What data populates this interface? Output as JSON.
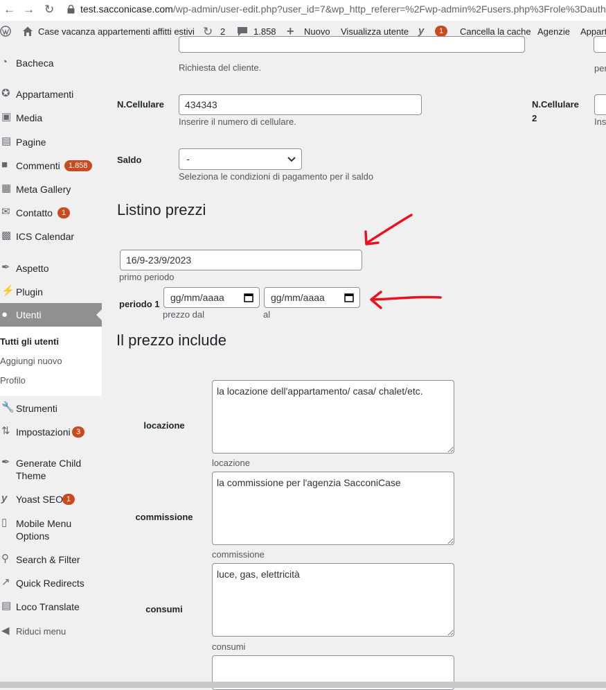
{
  "browser": {
    "url_host": "test.sacconicase.com",
    "url_rest": "/wp-admin/user-edit.php?user_id=7&wp_http_referer=%2Fwp-admin%2Fusers.php%3Frole%3Dauth"
  },
  "adminbar": {
    "site_name": "Case vacanza appartementi affitti estivi",
    "updates_count": "2",
    "comments_count": "1.858",
    "new_label": "Nuovo",
    "view_user": "Visualizza utente",
    "yoast_count": "1",
    "clear_cache": "Cancella la cache",
    "agenzie": "Agenzie",
    "appart": "Appart"
  },
  "sidebar": {
    "items": [
      {
        "label": "Bacheca",
        "icon": "dashboard-icon"
      },
      {
        "label": "Appartamenti",
        "icon": "pin-icon"
      },
      {
        "label": "Media",
        "icon": "media-icon"
      },
      {
        "label": "Pagine",
        "icon": "page-icon"
      },
      {
        "label": "Commenti",
        "icon": "comment-icon",
        "badge": "1.858"
      },
      {
        "label": "Meta Gallery",
        "icon": "gallery-icon"
      },
      {
        "label": "Contatto",
        "icon": "mail-icon",
        "badge": "1"
      },
      {
        "label": "ICS Calendar",
        "icon": "calendar-icon"
      },
      {
        "label": "Aspetto",
        "icon": "brush-icon"
      },
      {
        "label": "Plugin",
        "icon": "plugin-icon"
      },
      {
        "label": "Utenti",
        "icon": "user-icon"
      },
      {
        "label": "Strumenti",
        "icon": "wrench-icon"
      },
      {
        "label": "Impostazioni",
        "icon": "settings-icon",
        "badge": "3"
      },
      {
        "label": "Generate Child Theme",
        "icon": "brush-icon"
      },
      {
        "label": "Yoast SEO",
        "icon": "yoast-icon",
        "badge": "1"
      },
      {
        "label": "Mobile Menu Options",
        "icon": "mobile-icon"
      },
      {
        "label": "Search & Filter",
        "icon": "search-icon"
      },
      {
        "label": "Quick Redirects",
        "icon": "redirect-icon"
      },
      {
        "label": "Loco Translate",
        "icon": "translate-icon"
      },
      {
        "label": "Riduci menu",
        "icon": "collapse-icon"
      }
    ],
    "submenu": [
      "Tutti gli utenti",
      "Aggiungi nuovo",
      "Profilo"
    ]
  },
  "form": {
    "richiesta_desc": "Richiesta del cliente.",
    "right_partial_desc": "per",
    "cellulare_label": "N.Cellulare",
    "cellulare_value": "434343",
    "cellulare_desc": "Inserire il numero di cellulare.",
    "cellulare2_label_1": "N.Cellulare",
    "cellulare2_label_2": "2",
    "cellulare2_desc": "Ins",
    "saldo_label": "Saldo",
    "saldo_value": "-",
    "saldo_desc": "Seleziona le condizioni di pagamento per il saldo",
    "listino_title": "Listino prezzi",
    "primo_periodo_value": "16/9-23/9/2023",
    "primo_periodo_desc": "primo periodo",
    "periodo1_label": "periodo 1",
    "date_placeholder": "gg/mm/aaaa",
    "prezzo_dal": "prezzo dal",
    "al": "al",
    "include_title": "Il prezzo include",
    "locazione_label": "locazione",
    "locazione_value": "la locazione dell'appartamento/ casa/ chalet/etc.",
    "locazione_desc": "locazione",
    "commissione_label": "commissione",
    "commissione_value": "la commissione per l'agenzia SacconiCase",
    "commissione_desc": "commissione",
    "consumi_label": "consumi",
    "consumi_value": "luce, gas, elettricità",
    "consumi_desc": "consumi"
  },
  "colors": {
    "annotation_arrow": "#e8131f",
    "active_menu": "#909090",
    "badge": "#ca4a1f"
  }
}
